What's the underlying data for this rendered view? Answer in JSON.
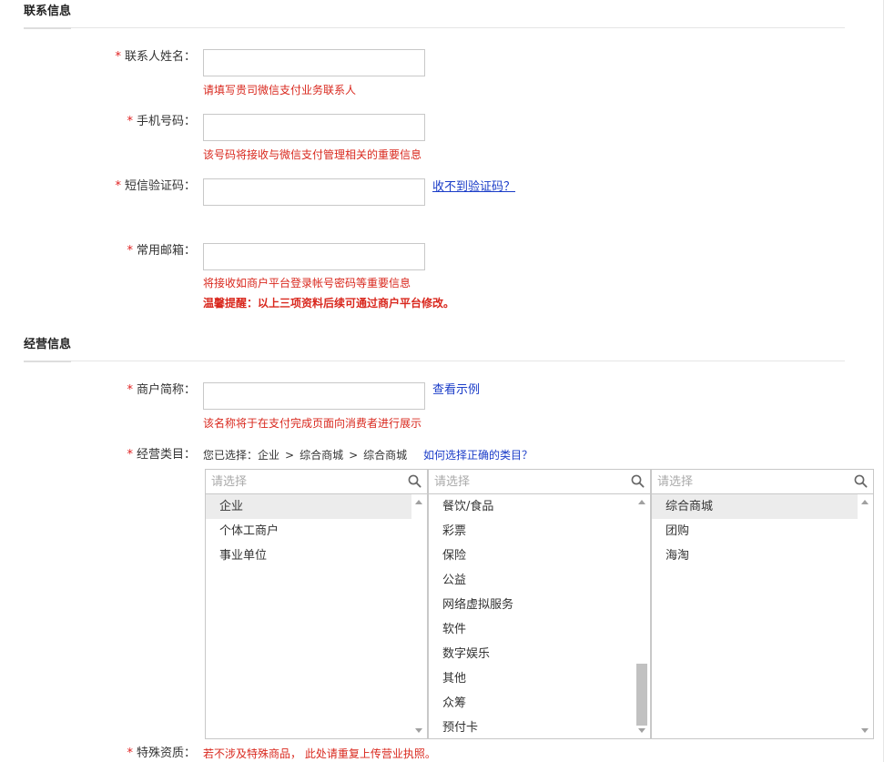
{
  "contact_section": {
    "title": "联系信息",
    "required_mark": "*",
    "contact_name": {
      "label": "联系人姓名：",
      "value": "",
      "hint": "请填写贵司微信支付业务联系人"
    },
    "mobile": {
      "label": "手机号码：",
      "value": "",
      "hint": "该号码将接收与微信支付管理相关的重要信息"
    },
    "sms_code": {
      "label": "短信验证码：",
      "value": "",
      "link": "收不到验证码？"
    },
    "email": {
      "label": "常用邮箱：",
      "value": "",
      "hint": "将接收如商户平台登录帐号密码等重要信息",
      "reminder": "温馨提醒：以上三项资料后续可通过商户平台修改。"
    }
  },
  "business_section": {
    "title": "经营信息",
    "required_mark": "*",
    "merchant_name": {
      "label": "商户简称：",
      "value": "",
      "link": "查看示例",
      "hint": "该名称将于在支付完成页面向消费者进行展示"
    },
    "category": {
      "label": "经营类目：",
      "selected_prefix": "您已选择：",
      "selected_path": [
        "企业",
        "综合商城",
        "综合商城"
      ],
      "separator": ">",
      "help_link": "如何选择正确的类目？",
      "columns": [
        {
          "placeholder": "请选择",
          "items": [
            "企业",
            "个体工商户",
            "事业单位"
          ],
          "selected_index": 0
        },
        {
          "placeholder": "请选择",
          "items": [
            "餐饮/食品",
            "彩票",
            "保险",
            "公益",
            "网络虚拟服务",
            "软件",
            "数字娱乐",
            "其他",
            "众筹",
            "预付卡"
          ],
          "selected_index": -1
        },
        {
          "placeholder": "请选择",
          "items": [
            "综合商城",
            "团购",
            "海淘"
          ],
          "selected_index": 0
        }
      ]
    },
    "special_qualification": {
      "label": "特殊资质：",
      "hint": "若不涉及特殊商品， 此处请重复上传营业执照。"
    }
  },
  "icons": {
    "search": "search-icon",
    "scroll_up": "chevron-up-icon",
    "scroll_down": "chevron-down-icon"
  }
}
